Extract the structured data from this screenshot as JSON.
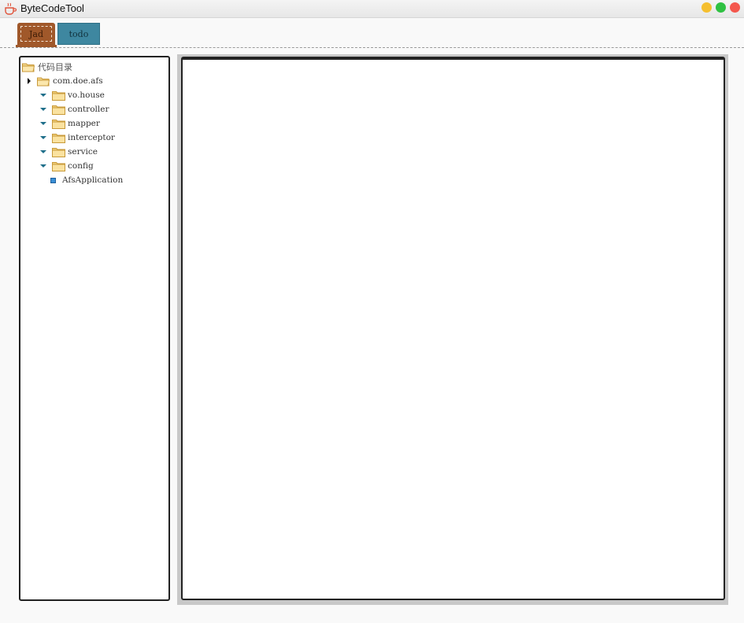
{
  "window": {
    "title": "ByteCodeTool",
    "icon": "java-cup-icon",
    "controls": {
      "minimize_color": "#f5bf2f",
      "maximize_color": "#2fc142",
      "close_color": "#f4574d"
    }
  },
  "tabs": [
    {
      "label": "Jad",
      "active": true,
      "color": "#a0582a"
    },
    {
      "label": "todo",
      "active": false,
      "color": "#3e87a0"
    }
  ],
  "tree": {
    "root_label": "代码目录",
    "package": {
      "label": "com.doe.afs",
      "expanded": false
    },
    "children": [
      {
        "label": "vo.house",
        "type": "folder"
      },
      {
        "label": "controller",
        "type": "folder"
      },
      {
        "label": "mapper",
        "type": "folder"
      },
      {
        "label": "interceptor",
        "type": "folder"
      },
      {
        "label": "service",
        "type": "folder"
      },
      {
        "label": "config",
        "type": "folder"
      },
      {
        "label": "AfsApplication",
        "type": "file"
      }
    ]
  },
  "editor": {
    "content": ""
  }
}
